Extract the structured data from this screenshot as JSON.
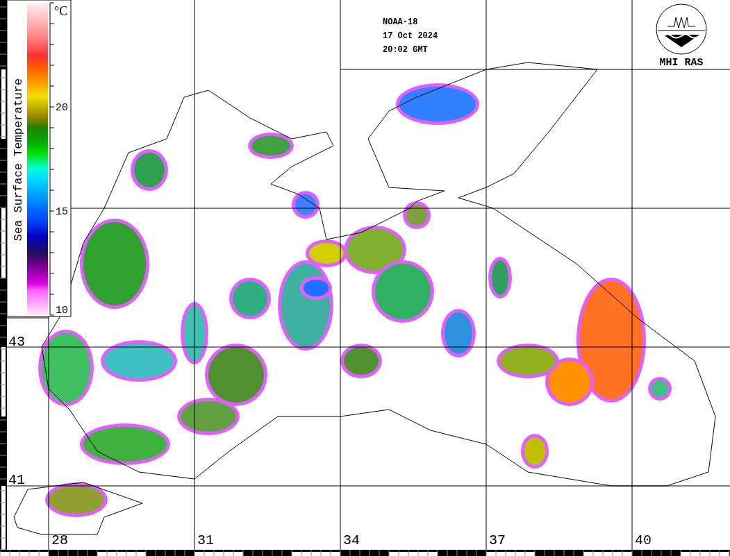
{
  "header": {
    "satellite": "NOAA-18",
    "date": "17 Oct 2024",
    "time": "20:02 GMT"
  },
  "logo": {
    "text": "MHI RAS"
  },
  "colorbar": {
    "title": "Sea Surface Temperature",
    "unit": "°C",
    "ticks": [
      "20",
      "15",
      "10"
    ]
  },
  "latitude_labels": [
    "43",
    "41"
  ],
  "longitude_labels": [
    "28",
    "31",
    "34",
    "37",
    "40"
  ]
}
